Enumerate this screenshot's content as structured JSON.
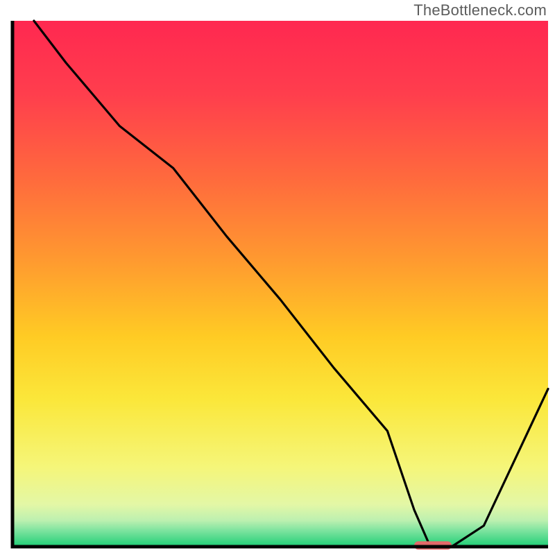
{
  "watermark": "TheBottleneck.com",
  "chart_data": {
    "type": "line",
    "title": "",
    "xlabel": "",
    "ylabel": "",
    "xlim": [
      0,
      100
    ],
    "ylim": [
      0,
      100
    ],
    "x": [
      4,
      10,
      20,
      30,
      40,
      50,
      60,
      70,
      75,
      78,
      82,
      88,
      100
    ],
    "values": [
      100,
      92,
      80,
      72,
      59,
      47,
      34,
      22,
      7,
      0,
      0,
      4,
      30
    ],
    "marker": {
      "x_start": 75,
      "x_end": 82,
      "y": 0
    },
    "gradient_stops": [
      {
        "offset": 0,
        "color": "#ff2850"
      },
      {
        "offset": 14,
        "color": "#ff3e4d"
      },
      {
        "offset": 30,
        "color": "#ff6a3d"
      },
      {
        "offset": 45,
        "color": "#ff9830"
      },
      {
        "offset": 60,
        "color": "#ffcb24"
      },
      {
        "offset": 72,
        "color": "#fbe73a"
      },
      {
        "offset": 85,
        "color": "#f5f67a"
      },
      {
        "offset": 92,
        "color": "#e3f7a6"
      },
      {
        "offset": 95,
        "color": "#bdf0b0"
      },
      {
        "offset": 97,
        "color": "#7be39e"
      },
      {
        "offset": 100,
        "color": "#1fce76"
      }
    ]
  },
  "plot": {
    "margin_top": 30,
    "margin_bottom": 12,
    "margin_left": 18,
    "margin_right": 10,
    "axis_width": 5,
    "axis_color": "#030303",
    "line_width": 3.2,
    "line_color": "#010101",
    "marker_color": "#e26a6a",
    "marker_height": 12,
    "marker_radius": 6
  }
}
